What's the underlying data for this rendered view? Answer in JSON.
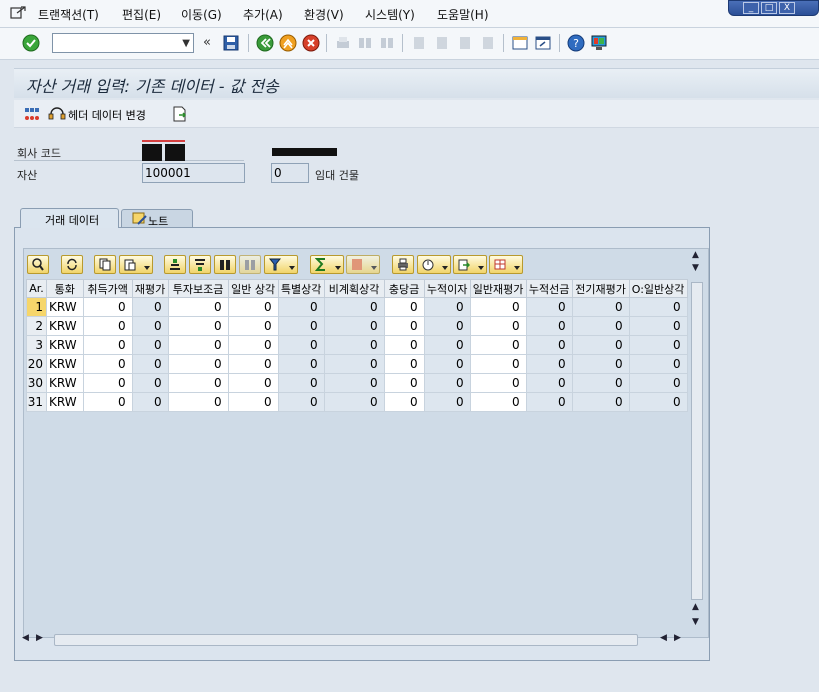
{
  "menu": {
    "items": [
      "트랜잭션(T)",
      "편집(E)",
      "이동(G)",
      "추가(A)",
      "환경(V)",
      "시스템(Y)",
      "도움말(H)"
    ]
  },
  "window_controls": {
    "minimize": "_",
    "maximize": "□",
    "close": "X"
  },
  "toolbar": {
    "command_field_value": "",
    "back_symbol": "«"
  },
  "title": "자산 거래 입력: 기존 데이터 - 값 전송",
  "app_toolbar": {
    "header_change_label": "헤더 데이터 변경"
  },
  "header": {
    "company_code_label": "회사 코드",
    "asset_label": "자산",
    "asset_value": "100001",
    "sub_number_value": "0",
    "lease_building_label": "임대 건물"
  },
  "tabs": [
    {
      "label": "거래 데이터",
      "active": true
    },
    {
      "label": "노트",
      "active": false
    }
  ],
  "grid": {
    "columns": [
      "Ar.",
      "통화",
      "취득가액",
      "재평가",
      "투자보조금",
      "일반 상각",
      "특별상각",
      "비계획상각",
      "충당금",
      "누적이자",
      "일반재평가",
      "누적선금",
      "전기재평가",
      "O:일반상각"
    ],
    "rows": [
      {
        "area": "1",
        "currency": "KRW",
        "values": [
          "0",
          "0",
          "0",
          "0",
          "0",
          "0",
          "0",
          "0",
          "0",
          "0",
          "0",
          "0"
        ]
      },
      {
        "area": "2",
        "currency": "KRW",
        "values": [
          "0",
          "0",
          "0",
          "0",
          "0",
          "0",
          "0",
          "0",
          "0",
          "0",
          "0",
          "0"
        ]
      },
      {
        "area": "3",
        "currency": "KRW",
        "values": [
          "0",
          "0",
          "0",
          "0",
          "0",
          "0",
          "0",
          "0",
          "0",
          "0",
          "0",
          "0"
        ]
      },
      {
        "area": "20",
        "currency": "KRW",
        "values": [
          "0",
          "0",
          "0",
          "0",
          "0",
          "0",
          "0",
          "0",
          "0",
          "0",
          "0",
          "0"
        ]
      },
      {
        "area": "30",
        "currency": "KRW",
        "values": [
          "0",
          "0",
          "0",
          "0",
          "0",
          "0",
          "0",
          "0",
          "0",
          "0",
          "0",
          "0"
        ]
      },
      {
        "area": "31",
        "currency": "KRW",
        "values": [
          "0",
          "0",
          "0",
          "0",
          "0",
          "0",
          "0",
          "0",
          "0",
          "0",
          "0",
          "0"
        ]
      }
    ]
  },
  "colors": {
    "selection": "#f6d66b",
    "title_bg": "#d6e0ea",
    "panel_bg": "#dbe4ee"
  }
}
